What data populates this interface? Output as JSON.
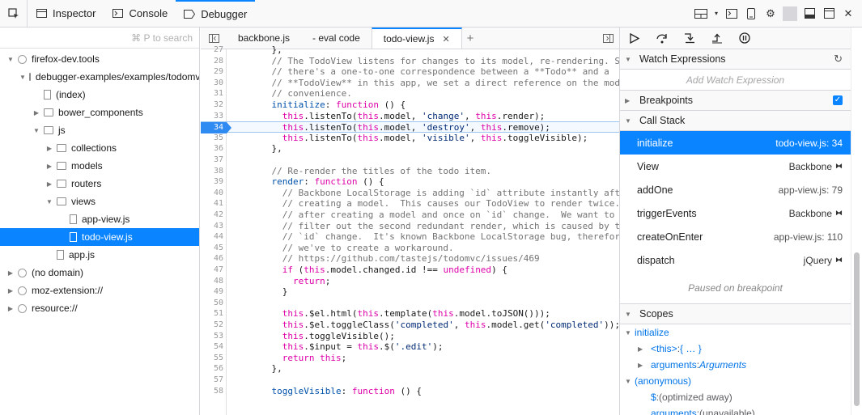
{
  "toolbar": {
    "tabs": [
      "Inspector",
      "Console",
      "Debugger"
    ],
    "active": "Debugger"
  },
  "sources": {
    "search_placeholder": "⌘ P to search",
    "tree": [
      {
        "label": "firefox-dev.tools",
        "indent": 0,
        "type": "globe",
        "expanded": true
      },
      {
        "label": "debugger-examples/examples/todomvc",
        "indent": 1,
        "type": "folder",
        "expanded": true
      },
      {
        "label": "(index)",
        "indent": 2,
        "type": "file"
      },
      {
        "label": "bower_components",
        "indent": 2,
        "type": "folder",
        "expanded": false
      },
      {
        "label": "js",
        "indent": 2,
        "type": "folder",
        "expanded": true
      },
      {
        "label": "collections",
        "indent": 3,
        "type": "folder",
        "expanded": false
      },
      {
        "label": "models",
        "indent": 3,
        "type": "folder",
        "expanded": false
      },
      {
        "label": "routers",
        "indent": 3,
        "type": "folder",
        "expanded": false
      },
      {
        "label": "views",
        "indent": 3,
        "type": "folder",
        "expanded": true
      },
      {
        "label": "app-view.js",
        "indent": 4,
        "type": "file"
      },
      {
        "label": "todo-view.js",
        "indent": 4,
        "type": "file",
        "selected": true
      },
      {
        "label": "app.js",
        "indent": 3,
        "type": "file"
      },
      {
        "label": "(no domain)",
        "indent": 0,
        "type": "globe",
        "expanded": false
      },
      {
        "label": "moz-extension://",
        "indent": 0,
        "type": "globe",
        "expanded": false
      },
      {
        "label": "resource://",
        "indent": 0,
        "type": "globe",
        "expanded": false
      }
    ]
  },
  "editor": {
    "tabs": [
      "backbone.js",
      "- eval code",
      "todo-view.js"
    ],
    "active_tab": "todo-view.js",
    "breakpoint_line": 34,
    "lines": [
      {
        "n": "27",
        "t": "    },"
      },
      {
        "n": "28",
        "t": "    // The TodoView listens for changes to its model, re-rendering. Since"
      },
      {
        "n": "29",
        "t": "    // there's a one-to-one correspondence between a **Todo** and a"
      },
      {
        "n": "30",
        "t": "    // **TodoView** in this app, we set a direct reference on the model for"
      },
      {
        "n": "31",
        "t": "    // convenience."
      },
      {
        "n": "32",
        "t": "    initialize: function () {"
      },
      {
        "n": "33",
        "t": "      this.listenTo(this.model, 'change', this.render);"
      },
      {
        "n": "34",
        "t": "      this.listenTo(this.model, 'destroy', this.remove);"
      },
      {
        "n": "35",
        "t": "      this.listenTo(this.model, 'visible', this.toggleVisible);"
      },
      {
        "n": "36",
        "t": "    },"
      },
      {
        "n": "37",
        "t": ""
      },
      {
        "n": "38",
        "t": "    // Re-render the titles of the todo item."
      },
      {
        "n": "39",
        "t": "    render: function () {"
      },
      {
        "n": "40",
        "t": "      // Backbone LocalStorage is adding `id` attribute instantly after"
      },
      {
        "n": "41",
        "t": "      // creating a model.  This causes our TodoView to render twice. Once"
      },
      {
        "n": "42",
        "t": "      // after creating a model and once on `id` change.  We want to"
      },
      {
        "n": "43",
        "t": "      // filter out the second redundant render, which is caused by this"
      },
      {
        "n": "44",
        "t": "      // `id` change.  It's known Backbone LocalStorage bug, therefore"
      },
      {
        "n": "45",
        "t": "      // we've to create a workaround."
      },
      {
        "n": "46",
        "t": "      // https://github.com/tastejs/todomvc/issues/469"
      },
      {
        "n": "47",
        "t": "      if (this.model.changed.id !== undefined) {"
      },
      {
        "n": "48",
        "t": "        return;"
      },
      {
        "n": "49",
        "t": "      }"
      },
      {
        "n": "50",
        "t": ""
      },
      {
        "n": "51",
        "t": "      this.$el.html(this.template(this.model.toJSON()));"
      },
      {
        "n": "52",
        "t": "      this.$el.toggleClass('completed', this.model.get('completed'));"
      },
      {
        "n": "53",
        "t": "      this.toggleVisible();"
      },
      {
        "n": "54",
        "t": "      this.$input = this.$('.edit');"
      },
      {
        "n": "55",
        "t": "      return this;"
      },
      {
        "n": "56",
        "t": "    },"
      },
      {
        "n": "57",
        "t": ""
      },
      {
        "n": "58",
        "t": "    toggleVisible: function () {"
      }
    ]
  },
  "right": {
    "watch": {
      "title": "Watch Expressions",
      "add": "Add Watch Expression"
    },
    "breakpoints": {
      "title": "Breakpoints"
    },
    "callstack": {
      "title": "Call Stack",
      "frames": [
        {
          "name": "initialize",
          "loc": "todo-view.js: 34",
          "selected": true
        },
        {
          "name": "View",
          "loc": "Backbone",
          "lib": true
        },
        {
          "name": "addOne",
          "loc": "app-view.js: 79"
        },
        {
          "name": "triggerEvents",
          "loc": "Backbone",
          "lib": true
        },
        {
          "name": "createOnEnter",
          "loc": "app-view.js: 110"
        },
        {
          "name": "dispatch",
          "loc": "jQuery",
          "lib": true
        }
      ],
      "paused": "Paused on breakpoint"
    },
    "scopes": {
      "title": "Scopes",
      "items": [
        {
          "label": "initialize",
          "kind": "header"
        },
        {
          "label": "<this>",
          "value": "{ … }",
          "kind": "prop"
        },
        {
          "label": "arguments",
          "value": "Arguments",
          "kind": "prop"
        },
        {
          "label": "(anonymous)",
          "kind": "header"
        },
        {
          "label": "$",
          "value": "(optimized away)",
          "kind": "leaf"
        },
        {
          "label": "arguments",
          "value": "(unavailable)",
          "kind": "leaf"
        }
      ]
    }
  }
}
